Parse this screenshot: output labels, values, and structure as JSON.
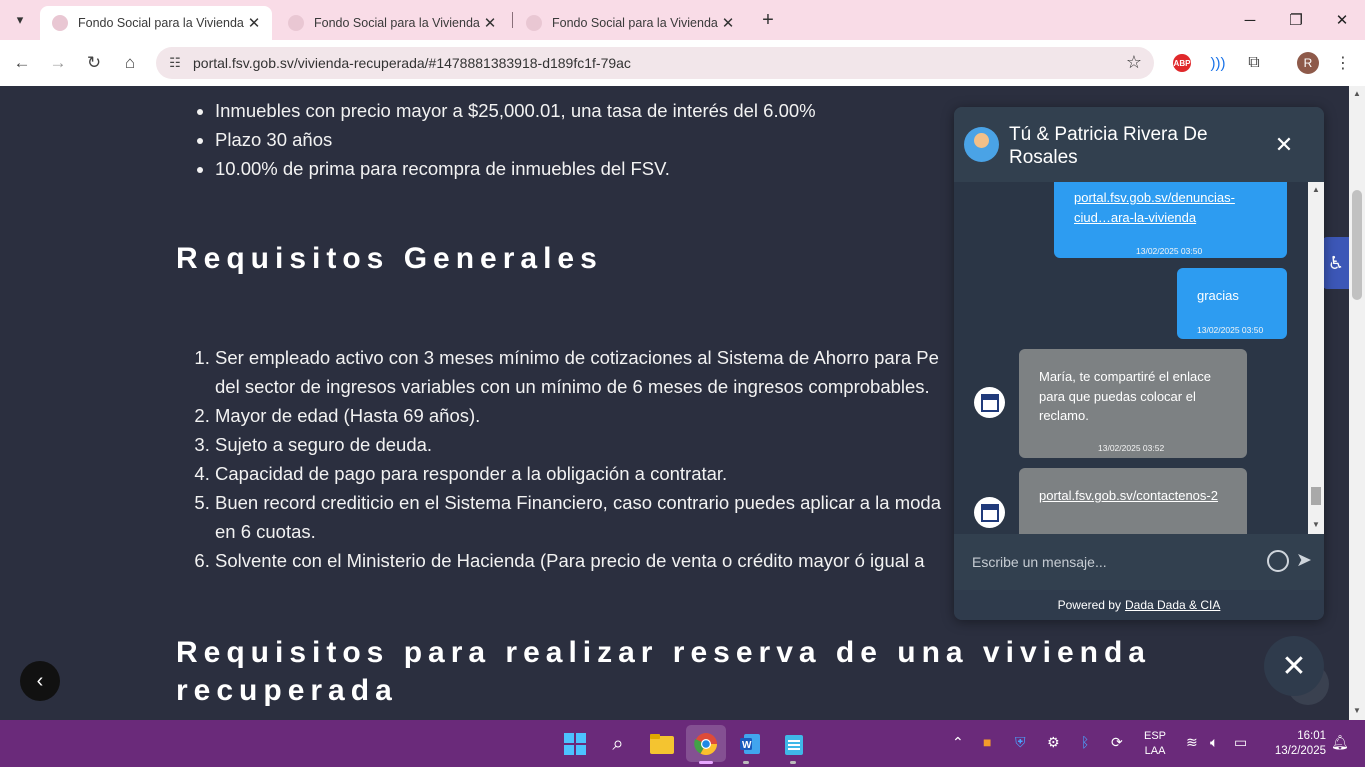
{
  "tabs": [
    {
      "title": "Fondo Social para la Vivienda -",
      "active": true
    },
    {
      "title": "Fondo Social para la Vivienda -",
      "active": false
    },
    {
      "title": "Fondo Social para la Vivienda -",
      "active": false
    }
  ],
  "address_bar": {
    "url": "portal.fsv.gob.sv/vivienda-recuperada/#1478881383918-d189fc1f-79ac"
  },
  "profile": {
    "initial": "R"
  },
  "extensions": {
    "abp_label": "ABP"
  },
  "page": {
    "bullets": [
      "Inmuebles con precio mayor a $25,000.01, una tasa de interés del 6.00%",
      "Plazo 30 años",
      "10.00% de prima para recompra de inmuebles del FSV."
    ],
    "heading_requisitos": "Requisitos Generales",
    "requisitos": [
      "Ser empleado activo con 3 meses mínimo de cotizaciones al Sistema de Ahorro para Pe",
      "del sector de ingresos variables con un mínimo de 6 meses de ingresos comprobables.",
      "Mayor de edad (Hasta 69 años).",
      "Sujeto a seguro de deuda.",
      "Capacidad de pago para responder a la obligación a contratar.",
      "Buen record crediticio en el Sistema Financiero, caso contrario puedes aplicar a la moda",
      "en 6 cuotas.",
      "Solvente con el Ministerio de Hacienda (Para precio de venta o crédito mayor ó igual a"
    ],
    "heading_reserva": "Requisitos para realizar reserva de una vivienda recuperada"
  },
  "chat": {
    "title": "Tú & Patricia Rivera De Rosales",
    "messages": [
      {
        "direction": "out",
        "link": "portal.fsv.gob.sv/denuncias-ciud…ara-la-vivienda",
        "time": "13/02/2025 03:50"
      },
      {
        "direction": "out",
        "text": "gracias",
        "time": "13/02/2025 03:50"
      },
      {
        "direction": "in",
        "text": "María, te compartiré el enlace para que puedas   colocar el reclamo.",
        "time": "13/02/2025 03:52"
      },
      {
        "direction": "in",
        "link": "portal.fsv.gob.sv/contactenos-2"
      }
    ],
    "input_placeholder": "Escribe un mensaje...",
    "powered_by": "Powered by",
    "powered_link": "Dada Dada & CIA"
  },
  "taskbar": {
    "language": "ESP",
    "layout": "LAA",
    "time": "16:01",
    "date": "13/2/2025"
  }
}
